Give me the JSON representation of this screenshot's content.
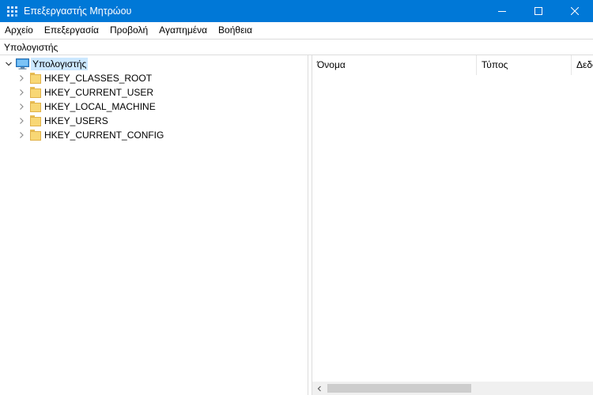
{
  "window": {
    "title": "Επεξεργαστής Μητρώου",
    "icon": "registry-editor-icon",
    "accent_color": "#0078d7"
  },
  "menu": {
    "items": [
      "Αρχείο",
      "Επεξεργασία",
      "Προβολή",
      "Αγαπημένα",
      "Βοήθεια"
    ]
  },
  "address": {
    "path": "Υπολογιστής"
  },
  "tree": {
    "root": {
      "label": "Υπολογιστής",
      "icon": "computer-icon",
      "expanded": true,
      "selected": true
    },
    "hives": [
      {
        "label": "HKEY_CLASSES_ROOT",
        "icon": "folder-icon"
      },
      {
        "label": "HKEY_CURRENT_USER",
        "icon": "folder-icon"
      },
      {
        "label": "HKEY_LOCAL_MACHINE",
        "icon": "folder-icon"
      },
      {
        "label": "HKEY_USERS",
        "icon": "folder-icon"
      },
      {
        "label": "HKEY_CURRENT_CONFIG",
        "icon": "folder-icon"
      }
    ]
  },
  "list": {
    "columns": [
      "Όνομα",
      "Τύπος",
      "Δεδομένα"
    ]
  }
}
